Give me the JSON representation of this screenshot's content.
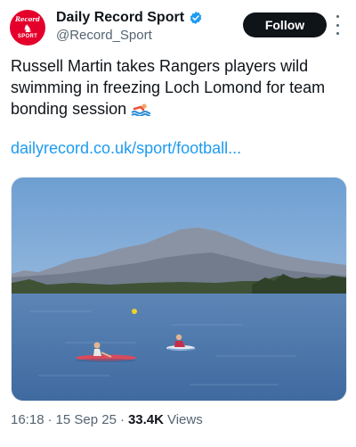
{
  "account": {
    "avatar_top": "Record",
    "avatar_bottom": "SPORT",
    "display_name": "Daily Record Sport",
    "handle": "@Record_Sport",
    "verified": true
  },
  "follow_label": "Follow",
  "tweet": {
    "text": "Russell Martin takes Rangers players wild swimming in freezing Loch Lomond for team bonding session",
    "emoji_icon": "person-swimming-icon",
    "link": "dailyrecord.co.uk/sport/football..."
  },
  "meta": {
    "time": "16:18",
    "separator": "·",
    "date": "15 Sep 25",
    "views_count": "33.4K",
    "views_label": "Views"
  },
  "colors": {
    "brand_red": "#e4002b",
    "link": "#1d9bf0",
    "verified": "#1d9bf0",
    "text": "#0f1419",
    "secondary": "#536471"
  }
}
